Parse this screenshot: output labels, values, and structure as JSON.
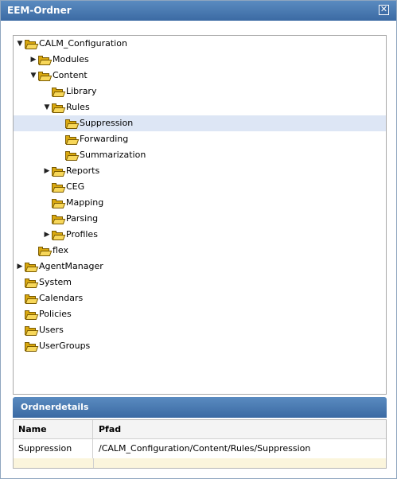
{
  "window": {
    "title": "EEM-Ordner",
    "close_label": "✕"
  },
  "tree": {
    "items": [
      {
        "label": "CALM_Configuration",
        "arrow": "▼"
      },
      {
        "label": "Modules",
        "arrow": "▶"
      },
      {
        "label": "Content",
        "arrow": "▼"
      },
      {
        "label": "Library",
        "arrow": ""
      },
      {
        "label": "Rules",
        "arrow": "▼"
      },
      {
        "label": "Suppression",
        "arrow": "",
        "selected": true
      },
      {
        "label": "Forwarding",
        "arrow": ""
      },
      {
        "label": "Summarization",
        "arrow": ""
      },
      {
        "label": "Reports",
        "arrow": "▶"
      },
      {
        "label": "CEG",
        "arrow": ""
      },
      {
        "label": "Mapping",
        "arrow": ""
      },
      {
        "label": "Parsing",
        "arrow": ""
      },
      {
        "label": "Profiles",
        "arrow": "▶"
      },
      {
        "label": "flex",
        "arrow": ""
      },
      {
        "label": "AgentManager",
        "arrow": "▶"
      },
      {
        "label": "System",
        "arrow": ""
      },
      {
        "label": "Calendars",
        "arrow": ""
      },
      {
        "label": "Policies",
        "arrow": ""
      },
      {
        "label": "Users",
        "arrow": ""
      },
      {
        "label": "UserGroups",
        "arrow": ""
      }
    ]
  },
  "details": {
    "title": "Ordnerdetails",
    "columns": [
      "Name",
      "Pfad"
    ],
    "row": {
      "name": "Suppression",
      "path": "/CALM_Configuration/Content/Rules/Suppression"
    }
  }
}
